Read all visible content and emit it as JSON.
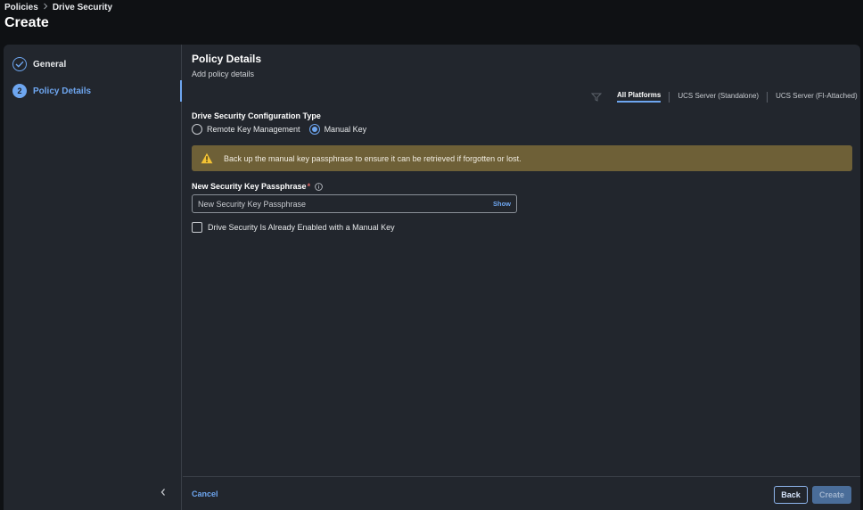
{
  "breadcrumb": {
    "items": [
      "Policies",
      "Drive Security"
    ]
  },
  "page": {
    "title": "Create"
  },
  "steps": [
    {
      "label": "General",
      "status": "completed"
    },
    {
      "number": "2",
      "label": "Policy Details",
      "status": "active"
    }
  ],
  "section": {
    "title": "Policy Details",
    "subtitle": "Add policy details"
  },
  "platform_tabs": {
    "filter_icon": "filter-icon",
    "items": [
      {
        "label": "All Platforms",
        "active": true
      },
      {
        "label": "UCS Server (Standalone)",
        "active": false
      },
      {
        "label": "UCS Server (FI-Attached)",
        "active": false
      }
    ]
  },
  "config_type": {
    "label": "Drive Security Configuration Type",
    "options": [
      {
        "label": "Remote Key Management",
        "selected": false
      },
      {
        "label": "Manual Key",
        "selected": true
      }
    ]
  },
  "warning": {
    "text": "Back up the manual key passphrase to ensure it can be retrieved if forgotten or lost.",
    "color": "#6e6037"
  },
  "passphrase": {
    "label": "New Security Key Passphrase",
    "required_marker": "*",
    "placeholder": "New Security Key Passphrase",
    "value": "",
    "show_label": "Show"
  },
  "already_enabled": {
    "label": "Drive Security Is Already Enabled with a Manual Key",
    "checked": false
  },
  "footer": {
    "cancel_label": "Cancel",
    "back_label": "Back",
    "create_label": "Create"
  },
  "colors": {
    "accent": "#6ea6f0",
    "panel": "#22262d",
    "background": "#0f1114"
  }
}
